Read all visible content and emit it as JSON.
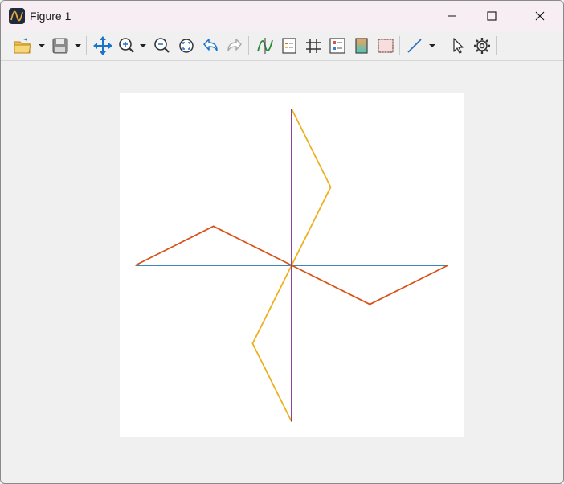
{
  "window": {
    "title": "Figure 1",
    "controls": [
      "minimize",
      "maximize",
      "close"
    ]
  },
  "toolbar": {
    "items": [
      {
        "name": "open-icon",
        "has_dropdown": true
      },
      {
        "name": "save-icon",
        "has_dropdown": true
      },
      {
        "name": "pan-icon"
      },
      {
        "name": "zoom-in-icon",
        "has_dropdown": true
      },
      {
        "name": "zoom-out-icon"
      },
      {
        "name": "zoom-fit-icon"
      },
      {
        "name": "undo-icon"
      },
      {
        "name": "redo-icon"
      },
      {
        "name": "data-cursor-icon"
      },
      {
        "name": "legend-icon"
      },
      {
        "name": "grid-icon"
      },
      {
        "name": "subplot-icon"
      },
      {
        "name": "colorbar-icon"
      },
      {
        "name": "border-icon"
      },
      {
        "name": "line-style-icon",
        "has_dropdown": true
      },
      {
        "name": "select-icon"
      },
      {
        "name": "settings-icon"
      }
    ]
  },
  "chart_data": {
    "type": "line",
    "title": "",
    "xlabel": "",
    "ylabel": "",
    "axes_visible": false,
    "xlim": [
      -1.1,
      1.1
    ],
    "ylim": [
      -1.1,
      1.1
    ],
    "series": [
      {
        "color": "#1f77b4",
        "x": [
          -1,
          0,
          1
        ],
        "y": [
          0,
          0,
          0
        ]
      },
      {
        "color": "#d95319",
        "x": [
          -1,
          -0.5,
          0,
          0.5,
          1
        ],
        "y": [
          0,
          0.25,
          0,
          -0.25,
          0
        ]
      },
      {
        "color": "#edb120",
        "x": [
          0,
          0.25,
          0,
          -0.25,
          0
        ],
        "y": [
          1,
          0.5,
          0,
          -0.5,
          -1
        ]
      },
      {
        "color": "#7e2f8e",
        "x": [
          0,
          0,
          0
        ],
        "y": [
          1,
          0,
          -1
        ]
      }
    ]
  }
}
